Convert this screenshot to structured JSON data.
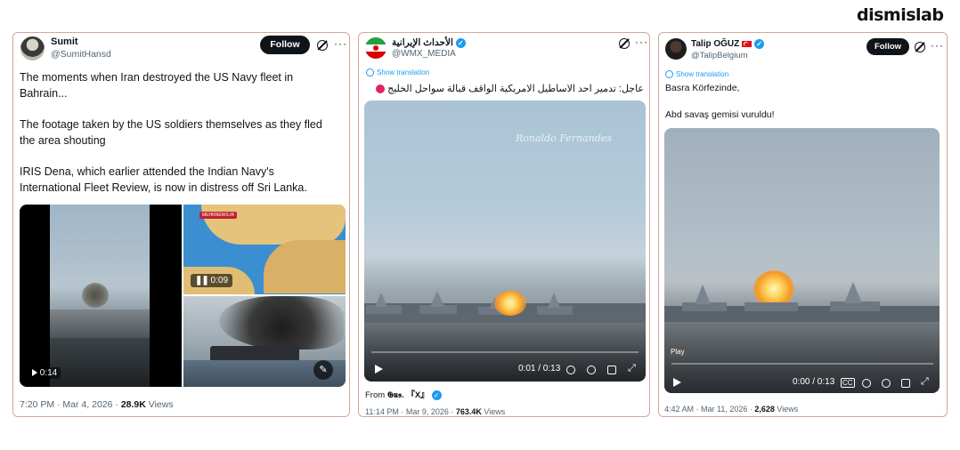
{
  "brand": {
    "logo_text": "dismislab"
  },
  "tweet1": {
    "name": "Sumit",
    "handle": "@SumitHansd",
    "follow_label": "Follow",
    "text_lines": [
      "The moments when Iran destroyed the US Navy fleet in",
      "Bahrain...",
      "The footage taken by the US soldiers themselves as they fled",
      "the area shouting",
      "IRIS Dena, which earlier attended the Indian Navy's",
      "International Fleet Review, is now in distress off Sri Lanka."
    ],
    "video_time": "0:14",
    "map_video_time": "0:09",
    "map_overlay_text": "MEHRNEWS.IR",
    "time": "7:20 PM · Mar 4, 2026 · ",
    "views_count": "28.9K",
    "views_label": " Views"
  },
  "tweet2": {
    "name": "الأحداث الإيرانية",
    "handle": "@WMX_MEDIA",
    "show_translation": "Show translation",
    "text": "عاجل: تدمير احد الاساطيل الامريكية الواقف قبالة سواحل الخليج",
    "watermark": "Ronaldo Fernandes",
    "video_time": "0:01 / 0:13",
    "from_prefix": "From ",
    "from_source": "𝕲𝖚𝖘. 『X』",
    "time": "11:14 PM · Mar 9, 2026 · ",
    "views_count": "763.4K",
    "views_label": " Views"
  },
  "tweet3": {
    "name": "Talip OĞUZ",
    "flag": "🇹🇷",
    "handle": "@TalipBelgium",
    "follow_label": "Follow",
    "show_translation": "Show translation",
    "text_line1": "Basra Körfezinde,",
    "text_line2": "Abd savaş gemisi vuruldu!",
    "play_tooltip": "Play",
    "video_time": "0:00 / 0:13",
    "time": "4:42 AM · Mar 11, 2026 · ",
    "views_count": "2,628",
    "views_label": " Views"
  },
  "icons": {
    "grok": "grok-icon",
    "more": "more-icon",
    "verified": "verified-badge-icon",
    "play": "play-icon",
    "pause": "pause-icon",
    "volume": "volume-icon",
    "settings": "settings-icon",
    "pip": "picture-in-picture-icon",
    "fullscreen": "fullscreen-icon",
    "edit": "edit-icon"
  },
  "colors": {
    "link": "#1d9bf0",
    "follow_bg": "#0f1419",
    "muted": "#536471",
    "card_border": "#d6a69a",
    "arabic_dot": "#e0245e"
  }
}
